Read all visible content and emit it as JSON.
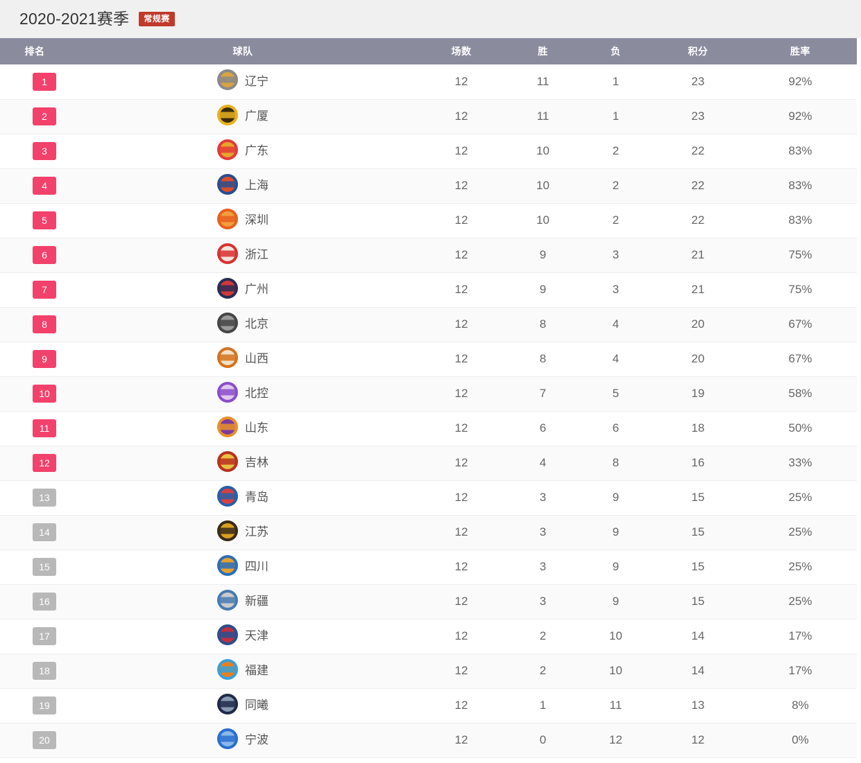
{
  "header": {
    "season_title": "2020-2021赛季",
    "phase_badge": "常规赛",
    "badge_color": "#c0392b"
  },
  "table": {
    "columns": [
      {
        "key": "rank",
        "label": "排名"
      },
      {
        "key": "team",
        "label": "球队"
      },
      {
        "key": "games",
        "label": "场数"
      },
      {
        "key": "win",
        "label": "胜"
      },
      {
        "key": "loss",
        "label": "负"
      },
      {
        "key": "points",
        "label": "积分"
      },
      {
        "key": "pct",
        "label": "胜率"
      }
    ],
    "header_bg": "#8b8b9e",
    "rank_badge_playoff_color": "#f2416b",
    "rank_badge_out_color": "#b8b8b8",
    "playoff_cutoff_rank": 12,
    "rows": [
      {
        "rank": "1",
        "team": "辽宁",
        "games": "12",
        "win": "11",
        "loss": "1",
        "points": "23",
        "pct": "92%",
        "logo": "liaoning-logo",
        "logo_colors": [
          "#8a8a8a",
          "#d9a441"
        ]
      },
      {
        "rank": "2",
        "team": "广厦",
        "games": "12",
        "win": "11",
        "loss": "1",
        "points": "23",
        "pct": "92%",
        "logo": "guangsha-logo",
        "logo_colors": [
          "#e8b21f",
          "#3a2a08"
        ]
      },
      {
        "rank": "3",
        "team": "广东",
        "games": "12",
        "win": "10",
        "loss": "2",
        "points": "22",
        "pct": "83%",
        "logo": "guangdong-logo",
        "logo_colors": [
          "#e23b3b",
          "#e8a52a"
        ]
      },
      {
        "rank": "4",
        "team": "上海",
        "games": "12",
        "win": "10",
        "loss": "2",
        "points": "22",
        "pct": "83%",
        "logo": "shanghai-logo",
        "logo_colors": [
          "#2b4d8f",
          "#d94f2a"
        ]
      },
      {
        "rank": "5",
        "team": "深圳",
        "games": "12",
        "win": "10",
        "loss": "2",
        "points": "22",
        "pct": "83%",
        "logo": "shenzhen-logo",
        "logo_colors": [
          "#e8601f",
          "#f2a03c"
        ]
      },
      {
        "rank": "6",
        "team": "浙江",
        "games": "12",
        "win": "9",
        "loss": "3",
        "points": "21",
        "pct": "75%",
        "logo": "zhejiang-logo",
        "logo_colors": [
          "#d83030",
          "#f0e4dc"
        ]
      },
      {
        "rank": "7",
        "team": "广州",
        "games": "12",
        "win": "9",
        "loss": "3",
        "points": "21",
        "pct": "75%",
        "logo": "guangzhou-logo",
        "logo_colors": [
          "#2c2c54",
          "#d03a3a"
        ]
      },
      {
        "rank": "8",
        "team": "北京",
        "games": "12",
        "win": "8",
        "loss": "4",
        "points": "20",
        "pct": "67%",
        "logo": "beijing-logo",
        "logo_colors": [
          "#454545",
          "#9a9a9a"
        ]
      },
      {
        "rank": "9",
        "team": "山西",
        "games": "12",
        "win": "8",
        "loss": "4",
        "points": "20",
        "pct": "67%",
        "logo": "shanxi-logo",
        "logo_colors": [
          "#d4721c",
          "#f0e0c8"
        ]
      },
      {
        "rank": "10",
        "team": "北控",
        "games": "12",
        "win": "7",
        "loss": "5",
        "points": "19",
        "pct": "58%",
        "logo": "beikong-logo",
        "logo_colors": [
          "#8b4fc9",
          "#e0c8f0"
        ]
      },
      {
        "rank": "11",
        "team": "山东",
        "games": "12",
        "win": "6",
        "loss": "6",
        "points": "18",
        "pct": "50%",
        "logo": "shandong-logo",
        "logo_colors": [
          "#e8902a",
          "#7a3aa0"
        ]
      },
      {
        "rank": "12",
        "team": "吉林",
        "games": "12",
        "win": "4",
        "loss": "8",
        "points": "16",
        "pct": "33%",
        "logo": "jilin-logo",
        "logo_colors": [
          "#b8301f",
          "#e8c040"
        ]
      },
      {
        "rank": "13",
        "team": "青岛",
        "games": "12",
        "win": "3",
        "loss": "9",
        "points": "15",
        "pct": "25%",
        "logo": "qingdao-logo",
        "logo_colors": [
          "#2a5fa8",
          "#d84040"
        ]
      },
      {
        "rank": "14",
        "team": "江苏",
        "games": "12",
        "win": "3",
        "loss": "9",
        "points": "15",
        "pct": "25%",
        "logo": "jiangsu-logo",
        "logo_colors": [
          "#3a2a1a",
          "#d8a020"
        ]
      },
      {
        "rank": "15",
        "team": "四川",
        "games": "12",
        "win": "3",
        "loss": "9",
        "points": "15",
        "pct": "25%",
        "logo": "sichuan-logo",
        "logo_colors": [
          "#2a6fb8",
          "#e8a030"
        ]
      },
      {
        "rank": "16",
        "team": "新疆",
        "games": "12",
        "win": "3",
        "loss": "9",
        "points": "15",
        "pct": "25%",
        "logo": "xinjiang-logo",
        "logo_colors": [
          "#4a7ab0",
          "#c8ccd0"
        ]
      },
      {
        "rank": "17",
        "team": "天津",
        "games": "12",
        "win": "2",
        "loss": "10",
        "points": "14",
        "pct": "17%",
        "logo": "tianjin-logo",
        "logo_colors": [
          "#2a4f8f",
          "#c03040"
        ]
      },
      {
        "rank": "18",
        "team": "福建",
        "games": "12",
        "win": "2",
        "loss": "10",
        "points": "14",
        "pct": "17%",
        "logo": "fujian-logo",
        "logo_colors": [
          "#3aa0d8",
          "#e88020"
        ]
      },
      {
        "rank": "19",
        "team": "同曦",
        "games": "12",
        "win": "1",
        "loss": "11",
        "points": "13",
        "pct": "8%",
        "logo": "tongxi-logo",
        "logo_colors": [
          "#1f2a4a",
          "#8a9ab0"
        ]
      },
      {
        "rank": "20",
        "team": "宁波",
        "games": "12",
        "win": "0",
        "loss": "12",
        "points": "12",
        "pct": "0%",
        "logo": "ningbo-logo",
        "logo_colors": [
          "#2a6fd0",
          "#8ab8e8"
        ]
      }
    ]
  }
}
